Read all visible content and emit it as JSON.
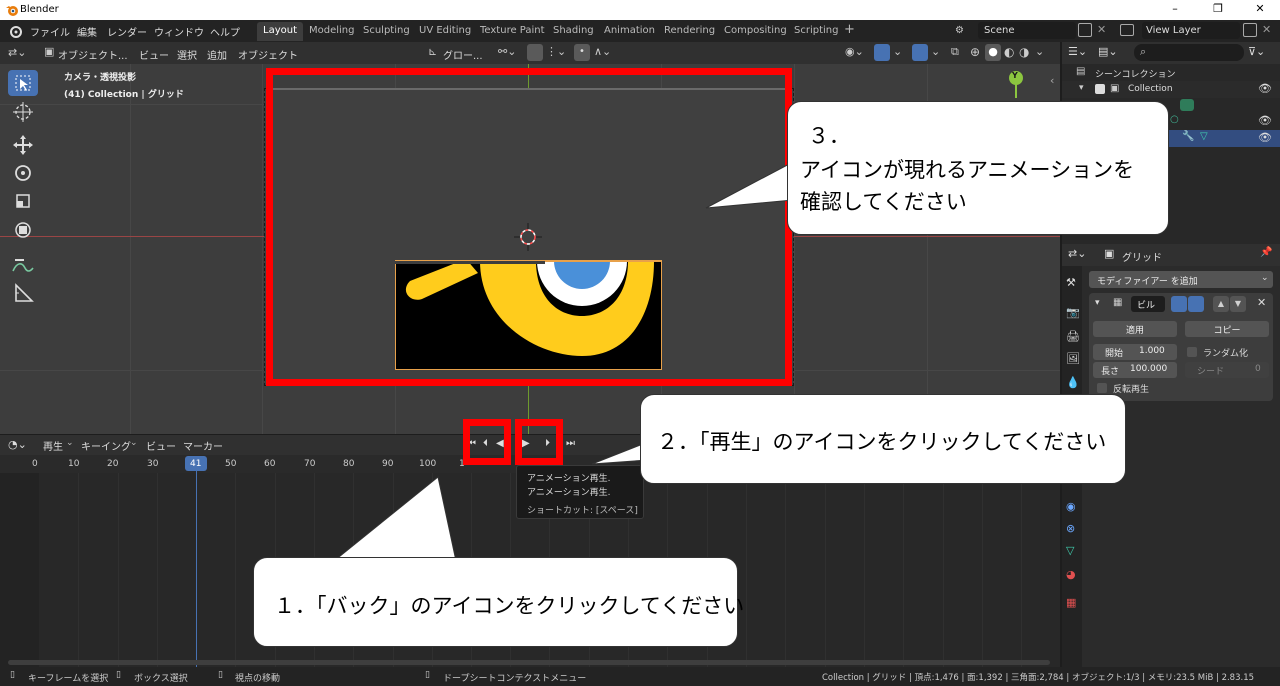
{
  "window": {
    "title": "Blender",
    "minimize": "–",
    "maximize": "❐",
    "close": "✕"
  },
  "menu": [
    "ファイル",
    "編集",
    "レンダー",
    "ウィンドウ",
    "ヘルプ"
  ],
  "workspaces": [
    "Layout",
    "Modeling",
    "Sculpting",
    "UV Editing",
    "Texture Paint",
    "Shading",
    "Animation",
    "Rendering",
    "Compositing",
    "Scripting"
  ],
  "add_workspace": "+",
  "scene": {
    "label": "Scene",
    "view_layer": "View Layer"
  },
  "viewport_header": {
    "mode": "オブジェクト...",
    "menus": [
      "ビュー",
      "選択",
      "追加",
      "オブジェクト"
    ],
    "transform": "グロー..."
  },
  "viewport": {
    "camera_label": "カメラ・透視投影",
    "collection_label": "(41) Collection | グリッド",
    "axis_y": "Y"
  },
  "timeline": {
    "menus": [
      "再生",
      "キーイング",
      "ビュー",
      "マーカー"
    ],
    "ticks": [
      "0",
      "10",
      "20",
      "30",
      "41",
      "50",
      "60",
      "70",
      "80",
      "90",
      "100",
      "1"
    ],
    "current_frame": "41"
  },
  "tooltip": {
    "line1": "アニメーション再生.",
    "line2": "アニメーション再生.",
    "shortcut": "ショートカット: [スペース]"
  },
  "outliner": {
    "scene_collection": "シーンコレクション",
    "collection": "Collection"
  },
  "properties": {
    "object_name": "グリッド",
    "add_modifier": "モディファイアー を追加",
    "modifier_name": "ビル",
    "apply": "適用",
    "copy": "コピー",
    "start_label": "開始",
    "start_value": "1.000",
    "random_label": "ランダム化",
    "length_label": "長さ",
    "length_value": "100.000",
    "seed_label": "シード",
    "seed_value": "0",
    "reverse_label": "反転再生"
  },
  "status": {
    "left1": "キーフレームを選択",
    "left2": "ボックス選択",
    "left3": "視点の移動",
    "left4": "ドープシートコンテクストメニュー",
    "right": "Collection | グリッド | 頂点:1,476 | 面:1,392 | 三角面:2,784 | オブジェクト:1/3 | メモリ:23.5 MiB | 2.83.15"
  },
  "annotations": {
    "step1": "１．「バック」のアイコンをクリックしてください",
    "step2": "２．「再生」のアイコンをクリックしてください",
    "step3_num": "３．",
    "step3_line1": "アイコンが現れるアニメーションを",
    "step3_line2": "確認してください"
  },
  "colors": {
    "accent": "#4772b3",
    "annotation_red": "#ff0000",
    "icon_yellow": "#ffcc1c",
    "icon_blue": "#4a90d9"
  }
}
